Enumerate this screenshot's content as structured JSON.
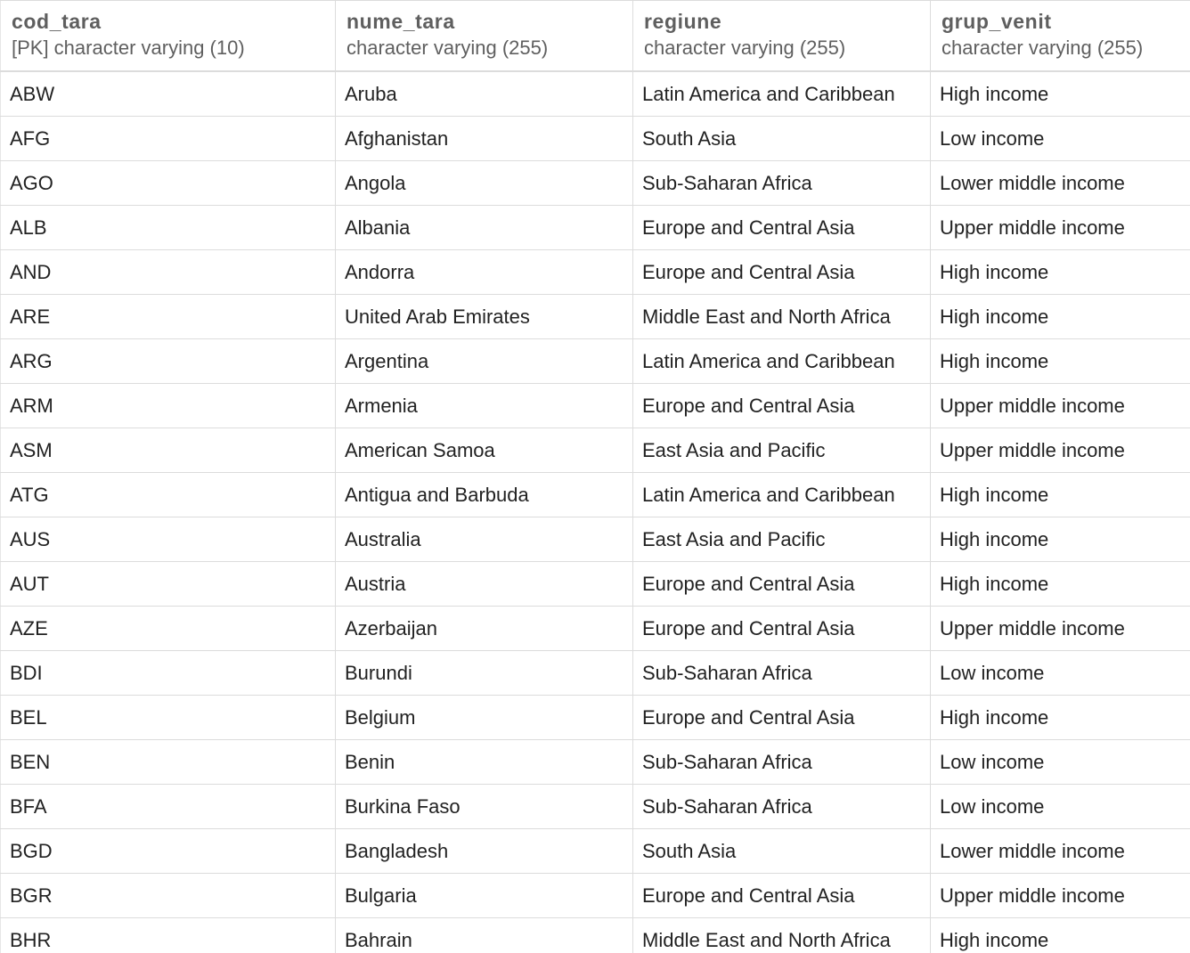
{
  "table": {
    "columns": [
      {
        "name": "cod_tara",
        "type": "[PK] character varying (10)"
      },
      {
        "name": "nume_tara",
        "type": "character varying (255)"
      },
      {
        "name": "regiune",
        "type": "character varying (255)"
      },
      {
        "name": "grup_venit",
        "type": "character varying (255)"
      }
    ],
    "rows": [
      [
        "ABW",
        "Aruba",
        "Latin America and  Caribbean",
        "High income"
      ],
      [
        "AFG",
        "Afghanistan",
        "South Asia",
        "Low income"
      ],
      [
        "AGO",
        "Angola",
        "Sub-Saharan Africa",
        "Lower middle income"
      ],
      [
        "ALB",
        "Albania",
        "Europe and  Central Asia",
        "Upper middle income"
      ],
      [
        "AND",
        "Andorra",
        "Europe and  Central Asia",
        "High income"
      ],
      [
        "ARE",
        "United Arab Emirates",
        "Middle East and  North Africa",
        "High income"
      ],
      [
        "ARG",
        "Argentina",
        "Latin America and  Caribbean",
        "High income"
      ],
      [
        "ARM",
        "Armenia",
        "Europe and  Central Asia",
        "Upper middle income"
      ],
      [
        "ASM",
        "American Samoa",
        "East Asia and  Pacific",
        "Upper middle income"
      ],
      [
        "ATG",
        "Antigua and Barbuda",
        "Latin America and  Caribbean",
        "High income"
      ],
      [
        "AUS",
        "Australia",
        "East Asia and  Pacific",
        "High income"
      ],
      [
        "AUT",
        "Austria",
        "Europe and  Central Asia",
        "High income"
      ],
      [
        "AZE",
        "Azerbaijan",
        "Europe and  Central Asia",
        "Upper middle income"
      ],
      [
        "BDI",
        "Burundi",
        "Sub-Saharan Africa",
        "Low income"
      ],
      [
        "BEL",
        "Belgium",
        "Europe and  Central Asia",
        "High income"
      ],
      [
        "BEN",
        "Benin",
        "Sub-Saharan Africa",
        "Low income"
      ],
      [
        "BFA",
        "Burkina Faso",
        "Sub-Saharan Africa",
        "Low income"
      ],
      [
        "BGD",
        "Bangladesh",
        "South Asia",
        "Lower middle income"
      ],
      [
        "BGR",
        "Bulgaria",
        "Europe and  Central Asia",
        "Upper middle income"
      ],
      [
        "BHR",
        "Bahrain",
        "Middle East and  North Africa",
        "High income"
      ]
    ]
  }
}
